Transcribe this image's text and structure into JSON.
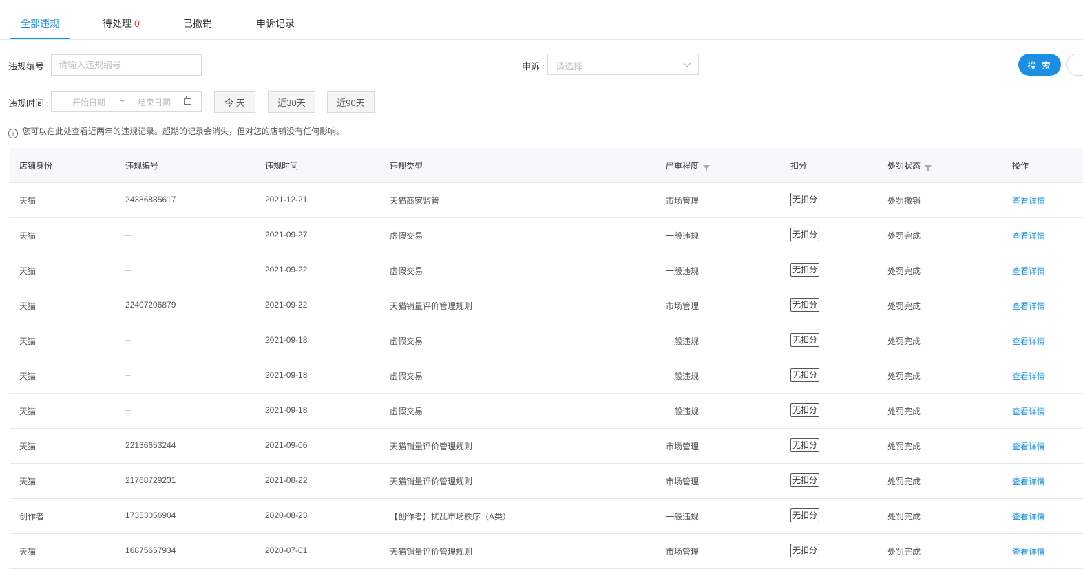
{
  "tabs": [
    {
      "label": "全部违规"
    },
    {
      "label": "待处理",
      "count": "0"
    },
    {
      "label": "已撤销"
    },
    {
      "label": "申诉记录"
    }
  ],
  "filters": {
    "violation_no_label": "违规编号 :",
    "violation_no_placeholder": "请输入违规编号",
    "appeal_label": "申诉 :",
    "appeal_placeholder": "请选择",
    "search_label": "搜 索",
    "time_label": "违规时间 :",
    "start_placeholder": "开始日期",
    "range_sep": "~",
    "end_placeholder": "结束日期",
    "quick": [
      "今 天",
      "近30天",
      "近90天"
    ]
  },
  "notice": "您可以在此处查看近两年的违规记录。超期的记录会消失，但对您的店铺没有任何影响。",
  "columns": [
    "店铺身份",
    "违规编号",
    "违规时间",
    "违规类型",
    "严重程度",
    "扣分",
    "处罚状态",
    "操作"
  ],
  "rows": [
    {
      "shop": "天猫",
      "no": "24386885617",
      "time": "2021-12-21",
      "type": "天猫商家监管",
      "level": "市场管理",
      "points": "无扣分",
      "status": "处罚撤销",
      "action": "查看详情"
    },
    {
      "shop": "天猫",
      "no": "--",
      "time": "2021-09-27",
      "type": "虚假交易",
      "level": "一般违规",
      "points": "无扣分",
      "status": "处罚完成",
      "action": "查看详情"
    },
    {
      "shop": "天猫",
      "no": "--",
      "time": "2021-09-22",
      "type": "虚假交易",
      "level": "一般违规",
      "points": "无扣分",
      "status": "处罚完成",
      "action": "查看详情"
    },
    {
      "shop": "天猫",
      "no": "22407206879",
      "time": "2021-09-22",
      "type": "天猫销量评价管理规则",
      "level": "市场管理",
      "points": "无扣分",
      "status": "处罚完成",
      "action": "查看详情"
    },
    {
      "shop": "天猫",
      "no": "--",
      "time": "2021-09-18",
      "type": "虚假交易",
      "level": "一般违规",
      "points": "无扣分",
      "status": "处罚完成",
      "action": "查看详情"
    },
    {
      "shop": "天猫",
      "no": "--",
      "time": "2021-09-18",
      "type": "虚假交易",
      "level": "一般违规",
      "points": "无扣分",
      "status": "处罚完成",
      "action": "查看详情"
    },
    {
      "shop": "天猫",
      "no": "--",
      "time": "2021-09-18",
      "type": "虚假交易",
      "level": "一般违规",
      "points": "无扣分",
      "status": "处罚完成",
      "action": "查看详情"
    },
    {
      "shop": "天猫",
      "no": "22136653244",
      "time": "2021-09-06",
      "type": "天猫销量评价管理规则",
      "level": "市场管理",
      "points": "无扣分",
      "status": "处罚完成",
      "action": "查看详情"
    },
    {
      "shop": "天猫",
      "no": "21768729231",
      "time": "2021-08-22",
      "type": "天猫销量评价管理规则",
      "level": "市场管理",
      "points": "无扣分",
      "status": "处罚完成",
      "action": "查看详情"
    },
    {
      "shop": "创作者",
      "no": "17353056904",
      "time": "2020-08-23",
      "type": "【创作者】扰乱市场秩序（A类）",
      "level": "一般违规",
      "points": "无扣分",
      "status": "处罚完成",
      "action": "查看详情"
    },
    {
      "shop": "天猫",
      "no": "16875657934",
      "time": "2020-07-01",
      "type": "天猫销量评价管理规则",
      "level": "市场管理",
      "points": "无扣分",
      "status": "处罚完成",
      "action": "查看详情"
    }
  ]
}
